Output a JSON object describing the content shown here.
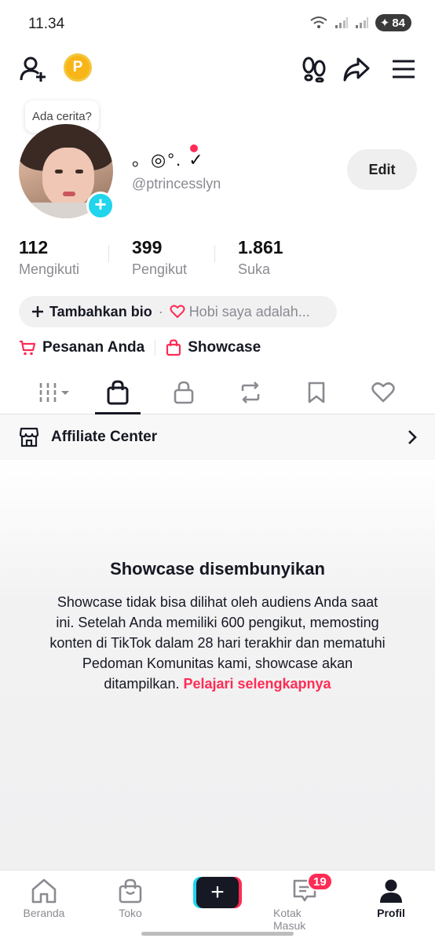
{
  "status_bar": {
    "time": "11.34",
    "battery": "84"
  },
  "top_nav": {
    "coin_label": "P"
  },
  "story_bubble": "Ada cerita?",
  "profile": {
    "display_name": "。◎°. ✓",
    "username": "@ptrincesslyn",
    "edit_label": "Edit"
  },
  "stats": [
    {
      "value": "112",
      "label": "Mengikuti"
    },
    {
      "value": "399",
      "label": "Pengikut"
    },
    {
      "value": "1.861",
      "label": "Suka"
    }
  ],
  "bio": {
    "add_label": "Tambahkan bio",
    "separator": "·",
    "hint": "Hobi saya adalah..."
  },
  "shop": {
    "orders_label": "Pesanan Anda",
    "showcase_label": "Showcase"
  },
  "tabs": [
    "videos-grid",
    "showcase",
    "private",
    "reposts",
    "favorites",
    "liked"
  ],
  "affiliate": {
    "label": "Affiliate Center"
  },
  "empty_state": {
    "title": "Showcase disembunyikan",
    "body": "Showcase tidak bisa dilihat oleh audiens Anda saat ini. Setelah Anda memiliki 600 pengikut, memosting konten di TikTok dalam 28 hari terakhir dan mematuhi Pedoman Komunitas kami, showcase akan ditampilkan.",
    "link": "Pelajari selengkapnya"
  },
  "bottom_nav": {
    "home": "Beranda",
    "shop": "Toko",
    "create": "+",
    "inbox": "Kotak Masuk",
    "inbox_badge": "19",
    "profile": "Profil"
  },
  "colors": {
    "accent": "#fe2c55",
    "cyan": "#20d5ec",
    "text": "#161823",
    "muted": "#8a8b91"
  }
}
